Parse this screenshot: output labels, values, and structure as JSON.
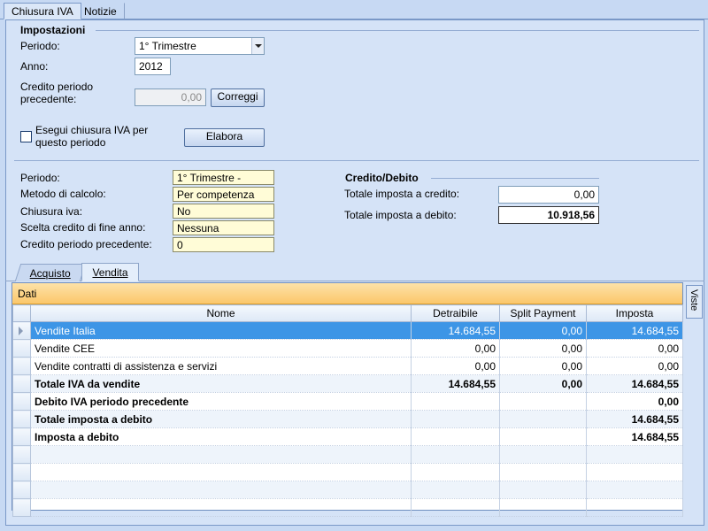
{
  "tabs": {
    "active": "Chiusura IVA",
    "other": "Notizie"
  },
  "impostazioni": {
    "title": "Impostazioni",
    "periodo_label": "Periodo:",
    "periodo_value": "1° Trimestre",
    "anno_label": "Anno:",
    "anno_value": "2012",
    "credito_label_1": "Credito periodo",
    "credito_label_2": "precedente:",
    "credito_value": "0,00",
    "correggi": "Correggi",
    "esegui_label_1": "Esegui chiusura IVA per",
    "esegui_label_2": "questo periodo",
    "elabora": "Elabora"
  },
  "riepilogo": {
    "periodo_label": "Periodo:",
    "periodo_value": "1° Trimestre -",
    "metodo_label": "Metodo di calcolo:",
    "metodo_value": "Per competenza",
    "chiusura_label": "Chiusura iva:",
    "chiusura_value": "No",
    "scelta_label": "Scelta credito di fine anno:",
    "scelta_value": "Nessuna",
    "credito_label": "Credito periodo precedente:",
    "credito_value": "0"
  },
  "credito_debito": {
    "title": "Credito/Debito",
    "credito_label": "Totale imposta a credito:",
    "credito_value": "0,00",
    "debito_label": "Totale imposta a debito:",
    "debito_value": "10.918,56"
  },
  "sub_tabs": {
    "acquisto": "Acquisto",
    "vendita": "Vendita"
  },
  "grid": {
    "bar_title": "Dati",
    "viste": "Viste",
    "columns": [
      "Nome",
      "Detraibile",
      "Split Payment",
      "Imposta"
    ],
    "rows": [
      {
        "nome": "Vendite Italia",
        "detraibile": "14.684,55",
        "split": "0,00",
        "imposta": "14.684,55"
      },
      {
        "nome": "Vendite CEE",
        "detraibile": "0,00",
        "split": "0,00",
        "imposta": "0,00"
      },
      {
        "nome": "Vendite contratti di assistenza e servizi",
        "detraibile": "0,00",
        "split": "0,00",
        "imposta": "0,00"
      },
      {
        "nome": "Totale IVA da vendite",
        "detraibile": "14.684,55",
        "split": "0,00",
        "imposta": "14.684,55"
      },
      {
        "nome": "Debito IVA periodo precedente",
        "detraibile": "",
        "split": "",
        "imposta": "0,00"
      },
      {
        "nome": "Totale imposta a debito",
        "detraibile": "",
        "split": "",
        "imposta": "14.684,55"
      },
      {
        "nome": "Imposta a debito",
        "detraibile": "",
        "split": "",
        "imposta": "14.684,55"
      }
    ]
  }
}
